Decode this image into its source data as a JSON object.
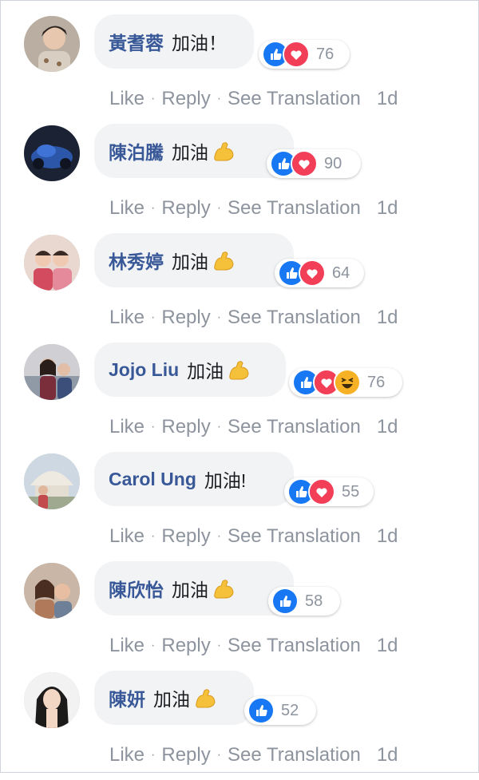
{
  "actions": {
    "like": "Like",
    "reply": "Reply",
    "see_translation": "See Translation",
    "separator": "·"
  },
  "colors": {
    "author": "#385898",
    "bubble_bg": "#f2f3f5",
    "like_blue": "#1877f2",
    "love_red": "#f33e58",
    "haha_yellow": "#f7b125",
    "muted": "#8d949e"
  },
  "comments": [
    {
      "author": "黃耆蓉",
      "text": "加油！",
      "flex_emoji": false,
      "reactions": [
        "like-icon",
        "love-icon"
      ],
      "reaction_count": "76",
      "time": "1d"
    },
    {
      "author": "陳泊騰",
      "text": "加油",
      "flex_emoji": true,
      "reactions": [
        "like-icon",
        "love-icon"
      ],
      "reaction_count": "90",
      "time": "1d"
    },
    {
      "author": "林秀婷",
      "text": "加油",
      "flex_emoji": true,
      "reactions": [
        "like-icon",
        "love-icon"
      ],
      "reaction_count": "64",
      "time": "1d"
    },
    {
      "author": "Jojo Liu",
      "text": "加油",
      "flex_emoji": true,
      "reactions": [
        "like-icon",
        "love-icon",
        "haha-icon"
      ],
      "reaction_count": "76",
      "time": "1d"
    },
    {
      "author": "Carol Ung",
      "text": "加油!",
      "flex_emoji": false,
      "reactions": [
        "like-icon",
        "love-icon"
      ],
      "reaction_count": "55",
      "time": "1d"
    },
    {
      "author": "陳欣怡",
      "text": "加油",
      "flex_emoji": true,
      "reactions": [
        "like-icon"
      ],
      "reaction_count": "58",
      "time": "1d"
    },
    {
      "author": "陳妍",
      "text": "加油",
      "flex_emoji": true,
      "reactions": [
        "like-icon"
      ],
      "reaction_count": "52",
      "time": "1d"
    }
  ]
}
